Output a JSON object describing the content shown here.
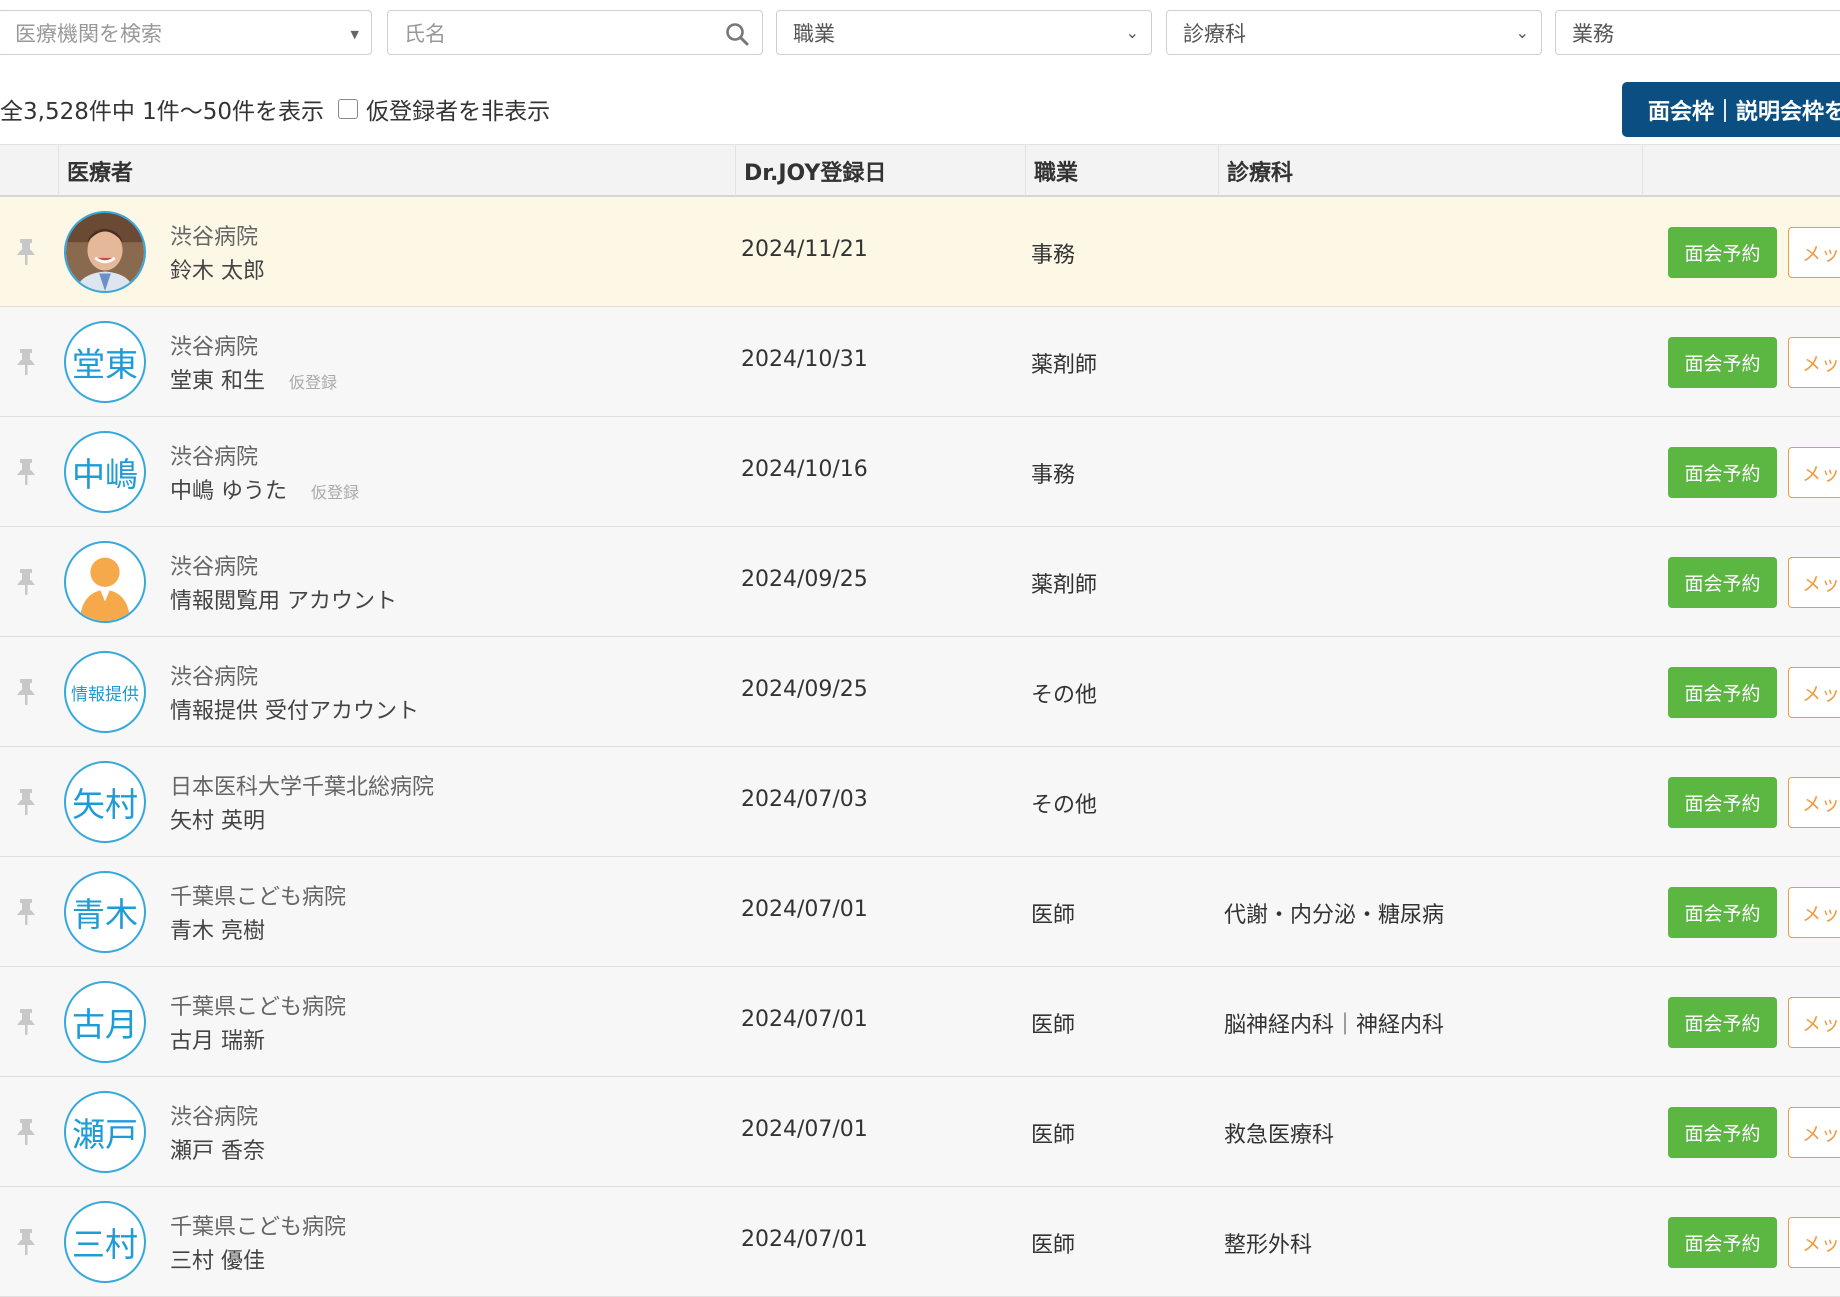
{
  "filters": {
    "institution_placeholder": "医療機関を検索",
    "name_placeholder": "氏名",
    "occupation": "職業",
    "department": "診療科",
    "business": "業務"
  },
  "summary": {
    "count_text": "全3,528件中 1件〜50件を表示",
    "hide_provisional_label": "仮登録者を非表示"
  },
  "top_button": "面会枠｜説明会枠を",
  "table": {
    "headers": [
      "医療者",
      "Dr.JOY登録日",
      "職業",
      "診療科"
    ],
    "rows": [
      {
        "institution": "渋谷病院",
        "name": "鈴木 太郎",
        "provisional": "",
        "avatar": "photo",
        "avatar_text": "",
        "date": "2024/11/21",
        "job": "事務",
        "dept": "",
        "highlight": true
      },
      {
        "institution": "渋谷病院",
        "name": "堂東 和生",
        "provisional": "仮登録",
        "avatar": "text",
        "avatar_text": "堂東",
        "date": "2024/10/31",
        "job": "薬剤師",
        "dept": "",
        "highlight": false
      },
      {
        "institution": "渋谷病院",
        "name": "中嶋 ゆうた",
        "provisional": "仮登録",
        "avatar": "text",
        "avatar_text": "中嶋",
        "date": "2024/10/16",
        "job": "事務",
        "dept": "",
        "highlight": false
      },
      {
        "institution": "渋谷病院",
        "name": "情報閲覧用 アカウント",
        "provisional": "",
        "avatar": "silhouette",
        "avatar_text": "",
        "date": "2024/09/25",
        "job": "薬剤師",
        "dept": "",
        "highlight": false
      },
      {
        "institution": "渋谷病院",
        "name": "情報提供 受付アカウント",
        "provisional": "",
        "avatar": "text-small",
        "avatar_text": "情報提供",
        "date": "2024/09/25",
        "job": "その他",
        "dept": "",
        "highlight": false
      },
      {
        "institution": "日本医科大学千葉北総病院",
        "name": "矢村 英明",
        "provisional": "",
        "avatar": "text",
        "avatar_text": "矢村",
        "date": "2024/07/03",
        "job": "その他",
        "dept": "",
        "highlight": false
      },
      {
        "institution": "千葉県こども病院",
        "name": "青木 亮樹",
        "provisional": "",
        "avatar": "text",
        "avatar_text": "青木",
        "date": "2024/07/01",
        "job": "医師",
        "dept": "代謝・内分泌・糖尿病",
        "highlight": false
      },
      {
        "institution": "千葉県こども病院",
        "name": "古月 瑞新",
        "provisional": "",
        "avatar": "text",
        "avatar_text": "古月",
        "date": "2024/07/01",
        "job": "医師",
        "dept": "脳神経内科｜神経内科",
        "highlight": false
      },
      {
        "institution": "渋谷病院",
        "name": "瀬戸 香奈",
        "provisional": "",
        "avatar": "text",
        "avatar_text": "瀬戸",
        "date": "2024/07/01",
        "job": "医師",
        "dept": "救急医療科",
        "highlight": false
      },
      {
        "institution": "千葉県こども病院",
        "name": "三村 優佳",
        "provisional": "",
        "avatar": "text",
        "avatar_text": "三村",
        "date": "2024/07/01",
        "job": "医師",
        "dept": "整形外科",
        "highlight": false
      }
    ]
  },
  "row_buttons": {
    "meeting": "面会予約",
    "message": "メッセ"
  },
  "colors": {
    "highlight_row": "#fdf8e6",
    "normal_row": "#f7f7f7",
    "meeting_button": "#5cb642",
    "message_border": "#f19a3e",
    "top_button": "#0b4f82",
    "avatar_border": "#35a8dd"
  }
}
